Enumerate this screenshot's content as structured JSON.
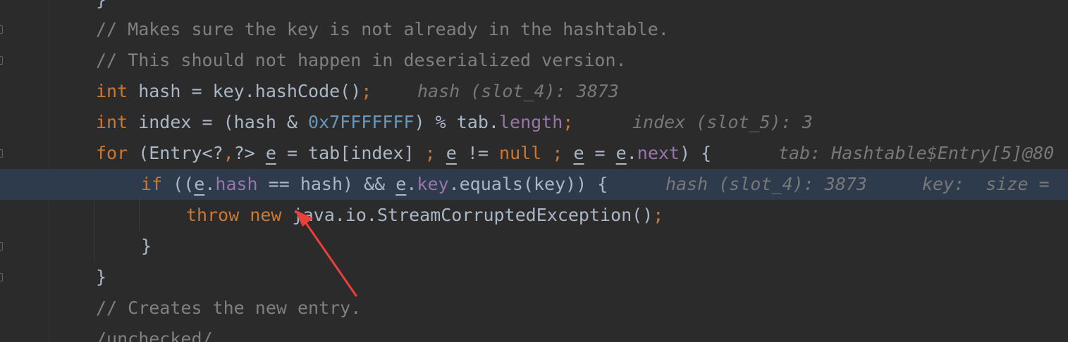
{
  "code_lines": {
    "l1": {
      "brace": "}"
    },
    "l2": {
      "comment": "// Makes sure the key is not already in the hashtable."
    },
    "l3": {
      "comment": "// This should not happen in deserialized version."
    },
    "l4": {
      "kw": "int",
      "t1": " hash = key.hashCode()",
      "semi": ";",
      "hint": "hash (slot_4): 3873"
    },
    "l5": {
      "kw": "int",
      "t1": " index = (hash & ",
      "num": "0x7FFFFFFF",
      "t2": ") % tab.",
      "fld": "length",
      "semi": ";",
      "hint": "index (slot_5): 3"
    },
    "l6": {
      "kw": "for",
      "t1": " (Entry<?",
      "comma": ",",
      "t2": "?> ",
      "v1": "e",
      "t3": " = tab[index] ",
      "semi1": ";",
      "t4": " ",
      "v2": "e",
      "t5": " != ",
      "null": "null",
      "t6": " ",
      "semi2": ";",
      "t7": " ",
      "v3": "e",
      "t8": " = ",
      "v4": "e",
      "t9": ".",
      "fld": "next",
      "t10": ") {",
      "hint": "tab: Hashtable$Entry[5]@80"
    },
    "l7": {
      "kw": "if",
      "t1": " ((",
      "v1": "e",
      "t2": ".",
      "fld1": "hash",
      "t3": " == hash) && ",
      "v2": "e",
      "t4": ".",
      "fld2": "key",
      "t5": ".equals(key)) {",
      "hint1": "hash (slot_4): 3873",
      "hint2": "key:  size = "
    },
    "l8": {
      "kw1": "throw",
      "kw2": "new",
      "t1": " java.io.StreamCorruptedException()",
      "semi": ";"
    },
    "l9": {
      "brace": "}"
    },
    "l10": {
      "brace": "}"
    },
    "l11": {
      "comment": "// Creates the new entry."
    },
    "l12": {
      "text": "/unchecked/"
    }
  },
  "colors": {
    "background": "#2b2b2b",
    "highlight_line": "#2d3b4d",
    "keyword": "#cc7832",
    "comment": "#808080",
    "number": "#6897bb",
    "field": "#9876aa",
    "hint": "#787878",
    "arrow": "#e8403a"
  }
}
